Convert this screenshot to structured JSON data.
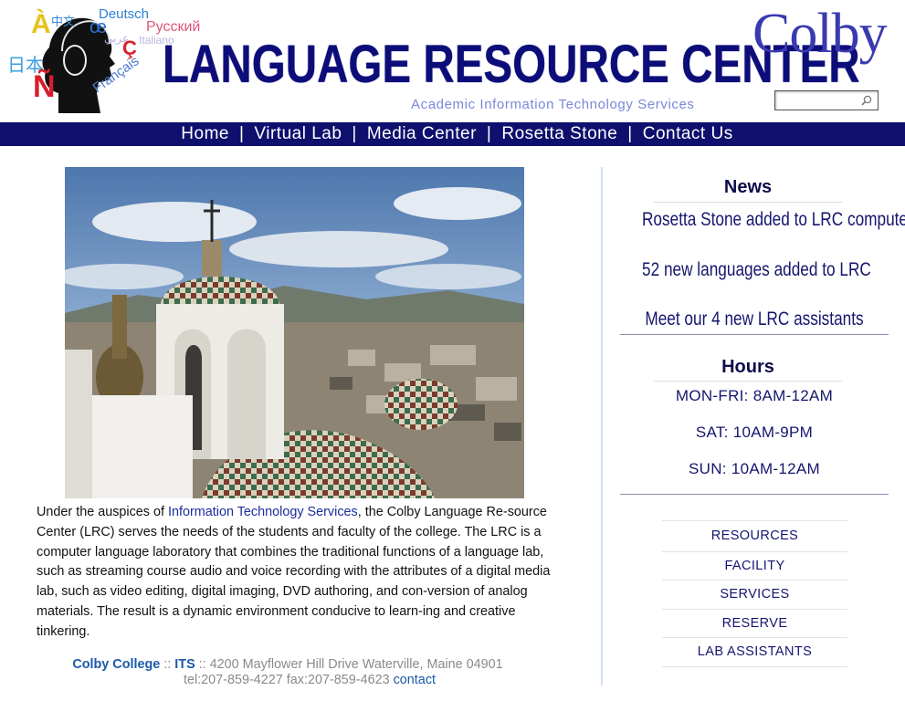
{
  "header": {
    "logo_words": [
      "À",
      "中文",
      "Deutsch",
      "Русский",
      "日本",
      "Ñ",
      "Français",
      "Ç",
      "œ"
    ],
    "title": "LANGUAGE RESOURCE CENTER",
    "subtitle": "Academic Information Technology Services",
    "college_logo": "Colby",
    "search": {
      "placeholder": "",
      "value": ""
    }
  },
  "nav": {
    "items": [
      {
        "label": "Home"
      },
      {
        "label": "Virtual Lab"
      },
      {
        "label": "Media Center"
      },
      {
        "label": "Rosetta Stone"
      },
      {
        "label": "Contact Us"
      }
    ],
    "separator": "|"
  },
  "main": {
    "intro_before_link": "Under the auspices of ",
    "intro_link": "Information Technology Services",
    "intro_after_link": ", the Colby Language Re-source Center (LRC) serves the needs of the students and faculty of the college. The LRC is a computer language laboratory that combines the traditional functions of a language lab, such as streaming course audio and voice recording with the attributes of a digital media lab, such as video editing, digital imaging, DVD authoring, and con-version of analog materials. The result is a dynamic environment conducive to learn-ing and creative tinkering."
  },
  "footer": {
    "college": "Colby College",
    "sep1": " :: ",
    "its": "ITS",
    "address": " :: 4200 Mayflower Hill Drive Waterville, Maine 04901",
    "phones": "tel:207-859-4227 fax:207-859-4623 ",
    "contact": "contact"
  },
  "sidebar": {
    "news_heading": "News",
    "news": [
      {
        "text": "Rosetta Stone added to LRC computers!"
      },
      {
        "text": "52 new languages added to LRC"
      },
      {
        "text": "Meet our 4 new LRC assistants"
      }
    ],
    "hours_heading": "Hours",
    "hours": [
      {
        "text": "MON-FRI: 8AM-12AM"
      },
      {
        "text": "SAT: 10AM-9PM"
      },
      {
        "text": "SUN: 10AM-12AM"
      }
    ],
    "menu": [
      {
        "label": "RESOURCES"
      },
      {
        "label": "FACILITY"
      },
      {
        "label": "SERVICES"
      },
      {
        "label": "RESERVE"
      },
      {
        "label": "LAB ASSISTANTS"
      }
    ]
  },
  "colors": {
    "brand_navy": "#0f0f6e",
    "title_blue": "#0d0d7a",
    "link_blue": "#1a2c9c",
    "footer_gray": "#8a8a8a"
  },
  "icons": [
    "headphones-silhouette-logo",
    "search-icon",
    "quito-dome-photo"
  ]
}
